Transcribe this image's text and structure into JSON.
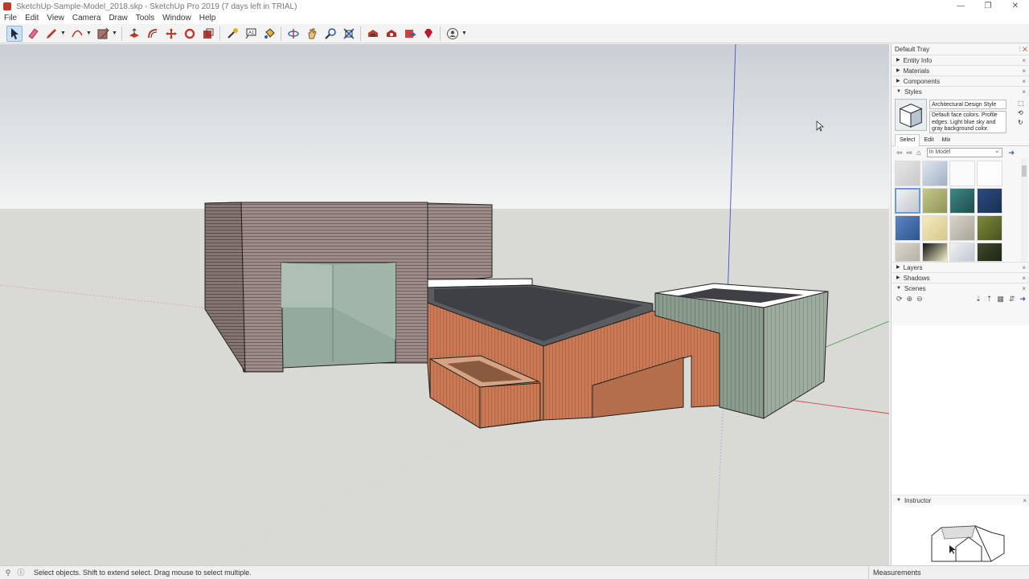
{
  "window": {
    "title": "SketchUp-Sample-Model_2018.skp - SketchUp Pro 2019 (7 days left in TRIAL)",
    "controls": [
      "—",
      "❐",
      "✕"
    ]
  },
  "menu": [
    "File",
    "Edit",
    "View",
    "Camera",
    "Draw",
    "Tools",
    "Window",
    "Help"
  ],
  "toolbar": {
    "tools": [
      "select-tool",
      "eraser-tool",
      "pencil-tool",
      "arc-tool",
      "rectangle-tool",
      "push-pull-tool",
      "offset-tool",
      "move-tool",
      "rotate-tool",
      "scale-tool",
      "tape-measure-tool",
      "text-tool",
      "paint-bucket-tool",
      "orbit-tool",
      "pan-tool",
      "zoom-tool",
      "zoom-extents-tool",
      "warehouse-tool",
      "extension-warehouse-tool",
      "layout-tool",
      "ruby-tool",
      "account-tool"
    ]
  },
  "tray": {
    "title": "Default Tray",
    "panels": {
      "entity_info": "Entity Info",
      "materials": "Materials",
      "components": "Components",
      "styles": "Styles",
      "layers": "Layers",
      "shadows": "Shadows",
      "scenes": "Scenes",
      "instructor": "Instructor"
    },
    "style": {
      "name": "Architectural Design Style",
      "description": "Default face colors. Profile edges. Light blue sky and gray background color."
    },
    "tabs": [
      "Select",
      "Edit",
      "Mix"
    ],
    "collection": "In Model"
  },
  "status": {
    "message": "Select objects. Shift to extend select. Drag mouse to select multiple.",
    "measurements_label": "Measurements"
  },
  "colors": {
    "sky_top": "#d6dbdf",
    "ground": "#d9d9d5",
    "wood": "#c97a55",
    "siding": "#9a8a87",
    "glass": "#94aa9e",
    "roof": "#3e4044",
    "selection_blue": "#6a9bd8"
  }
}
